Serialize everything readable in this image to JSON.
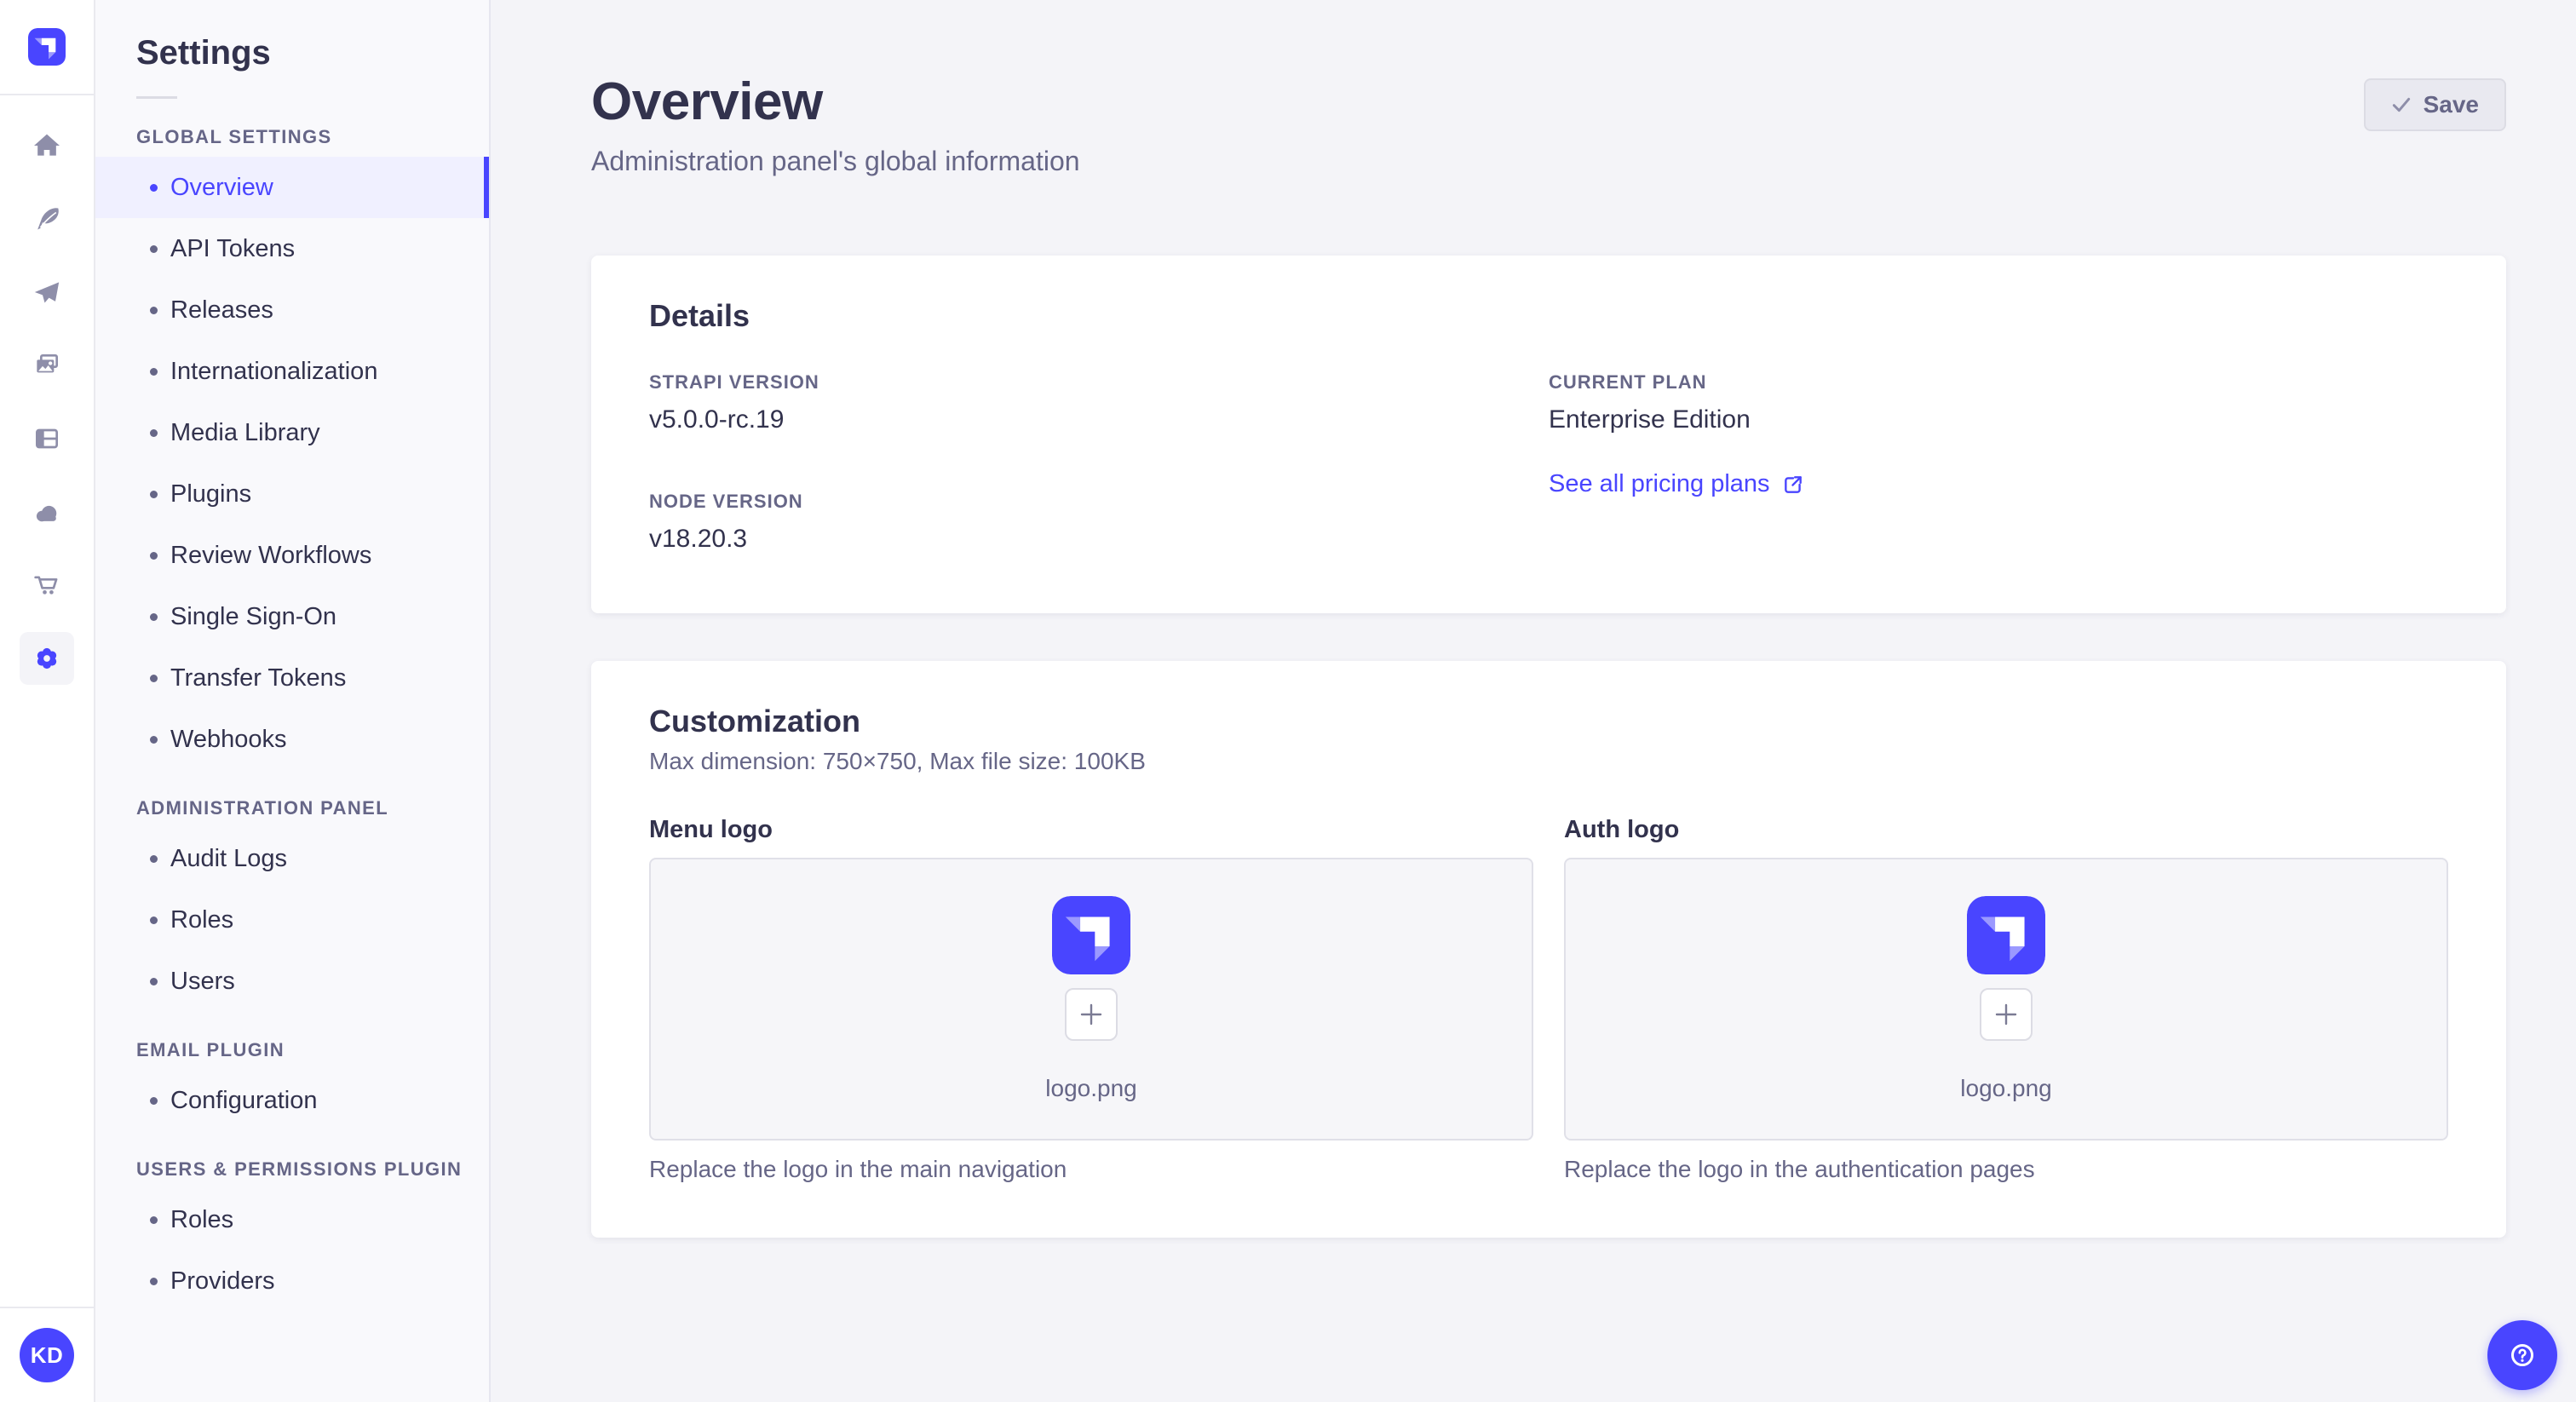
{
  "colors": {
    "primary": "#4945ff",
    "primary_light": "#f0f0ff",
    "text_dark": "#32324d",
    "text_muted": "#666687",
    "icon_gray": "#8e8ea9",
    "page_bg": "#f4f4f8",
    "card_bg": "#ffffff",
    "border": "#dcdce4"
  },
  "rail": {
    "logo_icon": "strapi-logo",
    "icons": [
      "home-icon",
      "feather-icon",
      "paper-plane-icon",
      "images-icon",
      "layout-icon",
      "cloud-icon",
      "cart-icon",
      "gear-icon"
    ],
    "active_icon": "gear-icon",
    "avatar_initials": "KD"
  },
  "subnav": {
    "title": "Settings",
    "groups": [
      {
        "label": "GLOBAL SETTINGS",
        "items": [
          {
            "label": "Overview",
            "active": true
          },
          {
            "label": "API Tokens"
          },
          {
            "label": "Releases"
          },
          {
            "label": "Internationalization"
          },
          {
            "label": "Media Library"
          },
          {
            "label": "Plugins"
          },
          {
            "label": "Review Workflows"
          },
          {
            "label": "Single Sign-On"
          },
          {
            "label": "Transfer Tokens"
          },
          {
            "label": "Webhooks"
          }
        ]
      },
      {
        "label": "ADMINISTRATION PANEL",
        "items": [
          {
            "label": "Audit Logs"
          },
          {
            "label": "Roles"
          },
          {
            "label": "Users"
          }
        ]
      },
      {
        "label": "EMAIL PLUGIN",
        "items": [
          {
            "label": "Configuration"
          }
        ]
      },
      {
        "label": "USERS & PERMISSIONS PLUGIN",
        "items": [
          {
            "label": "Roles"
          },
          {
            "label": "Providers"
          }
        ]
      }
    ]
  },
  "page": {
    "title": "Overview",
    "subtitle": "Administration panel's global information"
  },
  "toolbar": {
    "save_label": "Save",
    "save_icon": "check-icon"
  },
  "details": {
    "title": "Details",
    "strapi_version": {
      "label": "STRAPI VERSION",
      "value": "v5.0.0-rc.19"
    },
    "current_plan": {
      "label": "CURRENT PLAN",
      "value": "Enterprise Edition"
    },
    "pricing_link": "See all pricing plans",
    "pricing_link_icon": "external-link-icon",
    "node_version": {
      "label": "NODE VERSION",
      "value": "v18.20.3"
    }
  },
  "customization": {
    "title": "Customization",
    "subtitle": "Max dimension: 750×750, Max file size: 100KB",
    "menu_logo": {
      "label": "Menu logo",
      "filename": "logo.png",
      "caption": "Replace the logo in the main navigation",
      "add_icon": "plus-icon",
      "preview_icon": "strapi-logo"
    },
    "auth_logo": {
      "label": "Auth logo",
      "filename": "logo.png",
      "caption": "Replace the logo in the authentication pages",
      "add_icon": "plus-icon",
      "preview_icon": "strapi-logo"
    }
  },
  "help": {
    "icon": "question-mark-icon"
  }
}
